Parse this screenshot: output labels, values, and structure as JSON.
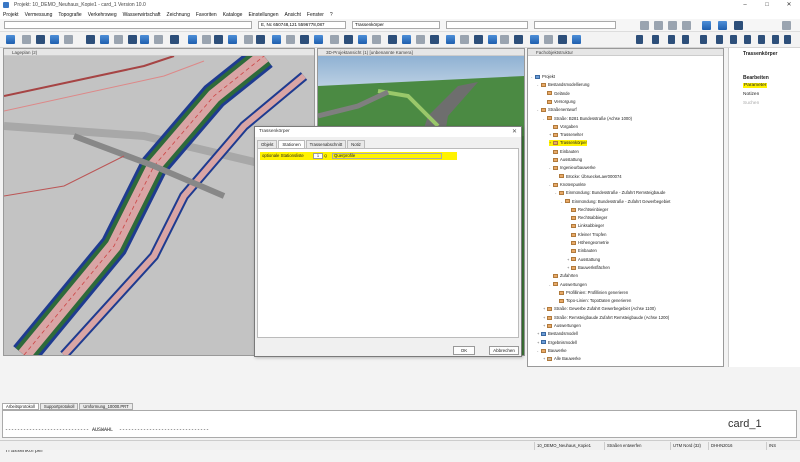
{
  "window": {
    "title": "Projekt: 10_DEMO_Neuhaus_Kopie1 - card_1 Version 10.0",
    "controls": {
      "minimize": "–",
      "maximize": "□",
      "close": "✕"
    }
  },
  "menu": [
    "Projekt",
    "Vermessung",
    "Topografie",
    "Verkehrsweg",
    "Wasserwirtschaft",
    "Zeichnung",
    "Favoriten",
    "Kataloge",
    "Einstellungen",
    "Ansicht",
    "Fenster",
    "?"
  ],
  "toolbar": {
    "coordinates": "E, Nc 650748,121 5596778,087",
    "object_combo": "Trassenkörper"
  },
  "views": {
    "map_title": "Lageplan (2)",
    "view3d_title": "3D-Projektansicht (1) [unbenannte Kamera]"
  },
  "dialog": {
    "title": "Trassenkörper",
    "tabs": [
      "Objekt",
      "Stationen",
      "Trassenabschnitt",
      "Notiz"
    ],
    "active_tab": "Stationen",
    "row_label": "optionale Stationsliste",
    "row_value": "1",
    "row_lookup": "Q",
    "row_field": "Querprofile",
    "ok": "OK",
    "cancel": "Abbrechen"
  },
  "tree": {
    "title": "Fachobjektstruktur",
    "nodes": [
      {
        "t": "Projekt",
        "d": 0,
        "ex": "-",
        "ic": "blue"
      },
      {
        "t": "Bestandsmodellierung",
        "d": 1,
        "ex": "-",
        "ic": "orange"
      },
      {
        "t": "Gelände",
        "d": 2,
        "ex": "",
        "ic": "orange"
      },
      {
        "t": "Versorgung",
        "d": 2,
        "ex": "",
        "ic": "orange"
      },
      {
        "t": "Straßenentwurf",
        "d": 1,
        "ex": "-",
        "ic": "orange"
      },
      {
        "t": "Straße: B281 Bundesstraße (Achse 1000)",
        "d": 2,
        "ex": "-",
        "ic": "orange"
      },
      {
        "t": "Vorgaben",
        "d": 3,
        "ex": "",
        "ic": "orange"
      },
      {
        "t": "Trassenelter",
        "d": 3,
        "ex": "+",
        "ic": "orange"
      },
      {
        "t": "Trassenkörper",
        "d": 3,
        "ex": "+",
        "ic": "orange",
        "hl": true
      },
      {
        "t": "Einbauten",
        "d": 3,
        "ex": "",
        "ic": "orange"
      },
      {
        "t": "Ausstattung",
        "d": 3,
        "ex": "",
        "ic": "orange"
      },
      {
        "t": "Ingenieurbauwerke",
        "d": 3,
        "ex": "-",
        "ic": "orange"
      },
      {
        "t": "Brücke: Übruecke­Laer000074",
        "d": 4,
        "ex": "",
        "ic": "orange"
      },
      {
        "t": "Knotenpunkte",
        "d": 3,
        "ex": "-",
        "ic": "orange"
      },
      {
        "t": "Einmündung: Bundesstraße - Zufahrt Remsteigbaude",
        "d": 4,
        "ex": "-",
        "ic": "orange"
      },
      {
        "t": "Einmündung: Bundesstraße - Zufahrt Gewerbegebiet",
        "d": 5,
        "ex": "-",
        "ic": "orange"
      },
      {
        "t": "Rechtseinbieger",
        "d": 6,
        "ex": "",
        "ic": "orange"
      },
      {
        "t": "Rechtsabbieger",
        "d": 6,
        "ex": "",
        "ic": "orange"
      },
      {
        "t": "Linksabbieger",
        "d": 6,
        "ex": "",
        "ic": "orange"
      },
      {
        "t": "Kleiner Tropfen",
        "d": 6,
        "ex": "",
        "ic": "orange"
      },
      {
        "t": "Höhengeometrie",
        "d": 6,
        "ex": "",
        "ic": "orange"
      },
      {
        "t": "Einbauten",
        "d": 6,
        "ex": "",
        "ic": "orange"
      },
      {
        "t": "Ausstattung",
        "d": 6,
        "ex": "+",
        "ic": "orange"
      },
      {
        "t": "Bauwerksflächen",
        "d": 6,
        "ex": "+",
        "ic": "orange"
      },
      {
        "t": "Zufahrten",
        "d": 3,
        "ex": "",
        "ic": "orange"
      },
      {
        "t": "Auswertungen",
        "d": 3,
        "ex": "-",
        "ic": "orange"
      },
      {
        "t": "Profillinien: Profillinien generieren",
        "d": 4,
        "ex": "",
        "ic": "orange"
      },
      {
        "t": "Topo-Linien: TopoDaten generieren",
        "d": 4,
        "ex": "",
        "ic": "orange"
      },
      {
        "t": "Straße: Gewerbe Zufahrt Gewerbegebiet (Achse 1100)",
        "d": 2,
        "ex": "+",
        "ic": "orange"
      },
      {
        "t": "Straße: Remsteigbaude Zufahrt Remsteigbaude (Achse 1200)",
        "d": 2,
        "ex": "+",
        "ic": "orange"
      },
      {
        "t": "Auswertungen",
        "d": 2,
        "ex": "+",
        "ic": "orange"
      },
      {
        "t": "Bestandsmodell",
        "d": 1,
        "ex": "+",
        "ic": "blue"
      },
      {
        "t": "Ergebnismodell",
        "d": 1,
        "ex": "+",
        "ic": "blue"
      },
      {
        "t": "Bauwerke",
        "d": 1,
        "ex": "-",
        "ic": "orange"
      },
      {
        "t": "Alle Bauwerke",
        "d": 2,
        "ex": "+",
        "ic": "grey"
      }
    ]
  },
  "rightpanel": {
    "title": "Trassenkörper",
    "heading": "Bearbeiten",
    "items": [
      "Parameter",
      "Notizen",
      "Suchen"
    ]
  },
  "bottom": {
    "tabs": [
      "Arbeitsprotokoll",
      "Supportprotokoll",
      "Umformung_10000.PRT"
    ],
    "protocol_line1": "---------------------------- AUSWAHL  ------------------------------",
    "protocol_line2": "Trassenkörper",
    "logo": "card_1"
  },
  "status": {
    "project": "10_DEMO_Neuhaus_Kopie1",
    "mode": "Straßen entwerfen",
    "crs": "UTM Nord (32)",
    "height": "DHHN2016",
    "ins": "INS"
  },
  "colors": {
    "highlight": "#fff200",
    "accent": "#0a6ec8",
    "road": "#2a4aa0"
  }
}
